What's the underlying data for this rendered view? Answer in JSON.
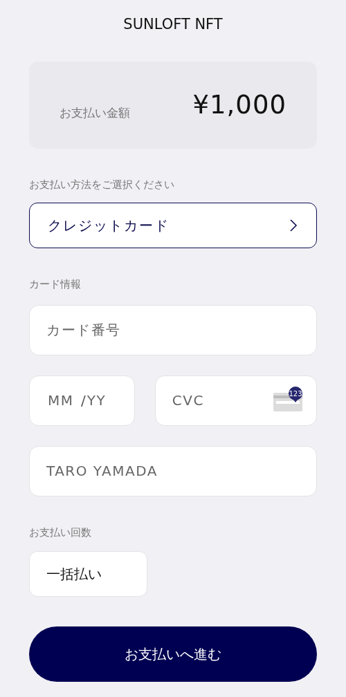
{
  "header": {
    "title": "SUNLOFT NFT"
  },
  "amount": {
    "label": "お支払い金額",
    "value": "¥1,000"
  },
  "method": {
    "label": "お支払い方法をご選択ください",
    "value": "クレジットカード"
  },
  "card": {
    "label": "カード情報",
    "number_placeholder": "カード番号",
    "month_placeholder": "MM",
    "separator": "/",
    "year_placeholder": "YY",
    "cvc_placeholder": "CVC",
    "cvc_badge": "123",
    "name_placeholder": "TARO YAMADA"
  },
  "installments": {
    "label": "お支払い回数",
    "value": "一括払い"
  },
  "submit": {
    "label": "お支払いへ進む"
  }
}
